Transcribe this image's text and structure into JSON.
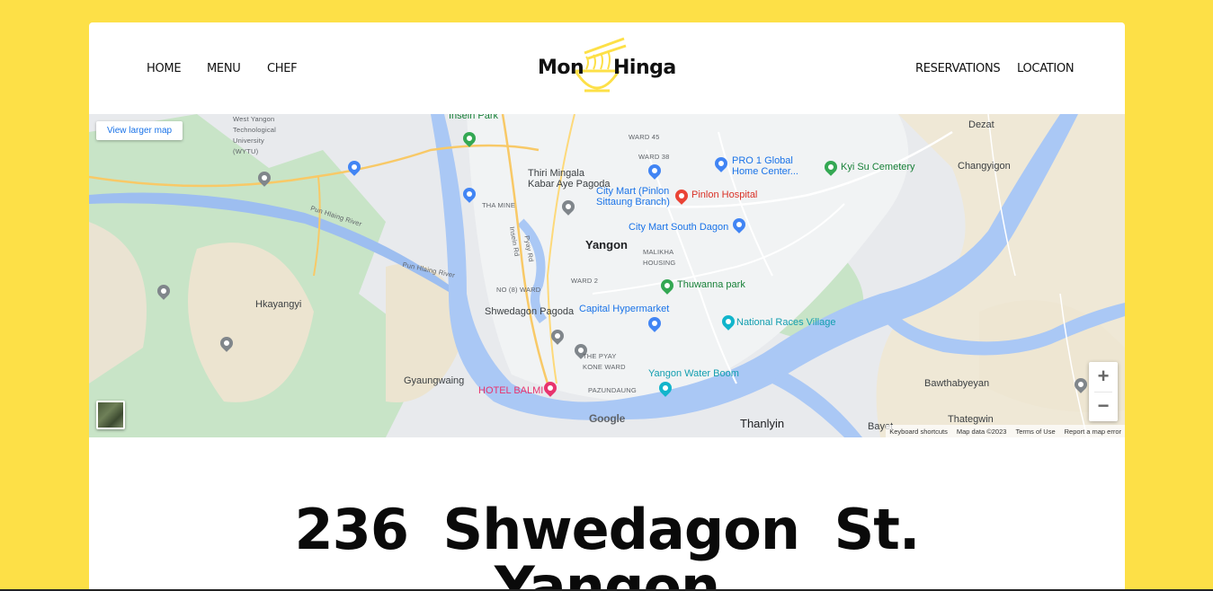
{
  "nav": {
    "left": [
      "HOME",
      "MENU",
      "CHEF"
    ],
    "right": [
      "RESERVATIONS",
      "LOCATION"
    ]
  },
  "logo": {
    "word1": "Mon",
    "word2": "Hinga"
  },
  "map": {
    "view_larger": "View larger map",
    "labels": {
      "west_yangon": "West Yangon\nTechnological\nUniversity\n(WYTU)",
      "insein_park": "Insein Park",
      "ward45": "WARD 45",
      "ward38": "WARD 38",
      "pro1": "PRO 1 Global\nHome Center...",
      "dezat": "Dezat",
      "kyi_su": "Kyi Su Cemetery",
      "changyigon": "Changyigon",
      "thiri": "Thiri Mingala\nKabar Aye Pagoda",
      "city_mart_pinlon": "City Mart (Pinlon\nSittaung Branch)",
      "pinlon_hospital": "Pinlon Hospital",
      "tha_mine": "THA MINE",
      "city_mart_south": "City Mart South Dagon",
      "pun_hlaing": "Pun Hlaing River",
      "pun_hlaing2": "Pun Hlaing River",
      "insein_rd": "Insein Rd",
      "pyay_rd": "Pyay Rd",
      "yangon": "Yangon",
      "malikha": "MALIKHA\nHOUSING",
      "ward2": "WARD 2",
      "no8ward": "NO (8) WARD",
      "hkayangyi": "Hkayangyi",
      "thuwanna": "Thuwanna park",
      "shwedagon": "Shwedagon Pagoda",
      "capital": "Capital Hypermarket",
      "national_races": "National Races Village",
      "the_pyay": "THE PYAY\nKONE WARD",
      "gyaungwaing": "Gyaungwaing",
      "yangon_water": "Yangon Water Boom",
      "bawthabyeyan": "Bawthabyeyan",
      "hotel_balmi": "HOTEL BALMI",
      "pazundaung": "PAZUNDAUNG",
      "thanlyin": "Thanlyin",
      "thategwin": "Thategwin",
      "bayet": "Bayet",
      "google": "Google"
    },
    "footer": [
      "Keyboard shortcuts",
      "Map data ©2023",
      "Terms of Use",
      "Report a map error"
    ],
    "zoom_in": "+",
    "zoom_out": "−"
  },
  "address": {
    "line1": "236  Shwedagon  St.",
    "line2": "Yangon"
  },
  "colors": {
    "background": "#fde047",
    "card": "#ffffff",
    "water": "#aac8f5",
    "park": "#c5e6c8"
  }
}
